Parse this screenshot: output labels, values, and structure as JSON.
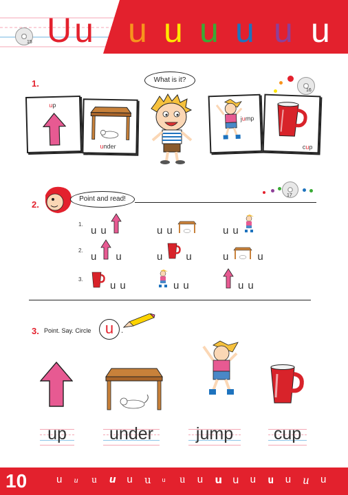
{
  "header": {
    "big_letters": "Uu",
    "cd_track": "15",
    "small_letters": [
      {
        "char": "u",
        "color": "#f7941d"
      },
      {
        "char": "u",
        "color": "#ffe600"
      },
      {
        "char": "u",
        "color": "#3aaa35"
      },
      {
        "char": "u",
        "color": "#1e73be"
      },
      {
        "char": "u",
        "color": "#8e3f98"
      },
      {
        "char": "u",
        "color": "#ffffff"
      }
    ]
  },
  "section1": {
    "number": "1.",
    "bubble": "What is it?",
    "cd_track": "16",
    "cards": [
      {
        "hl": "u",
        "rest": "p",
        "name": "up"
      },
      {
        "hl": "u",
        "rest": "nder",
        "name": "under"
      },
      {
        "pre": "j",
        "hl": "u",
        "rest": "mp",
        "name": "jump"
      },
      {
        "pre": "c",
        "hl": "u",
        "rest": "p",
        "name": "cup"
      }
    ]
  },
  "section2": {
    "number": "2.",
    "bubble": "Point and read!",
    "cd_track": "17",
    "rows": [
      {
        "n": "1.",
        "groups": [
          [
            "u",
            "u",
            "arrow"
          ],
          [
            "u",
            "u",
            "table"
          ],
          [
            "u",
            "u",
            "girl"
          ]
        ]
      },
      {
        "n": "2.",
        "groups": [
          [
            "u",
            "arrow",
            "u"
          ],
          [
            "u",
            "cup",
            "u"
          ],
          [
            "u",
            "table",
            "u"
          ]
        ]
      },
      {
        "n": "3.",
        "groups": [
          [
            "cup",
            "u",
            "u"
          ],
          [
            "girl",
            "u",
            "u"
          ],
          [
            "arrow",
            "u",
            "u"
          ]
        ]
      }
    ]
  },
  "section3": {
    "number": "3.",
    "instruction": "Point. Say. Circle",
    "circle_letter": "u",
    "trail": ".",
    "words": [
      "up",
      "under",
      "jump",
      "cup"
    ]
  },
  "footer": {
    "page_number": "10",
    "letters": [
      "u",
      "u",
      "u",
      "u",
      "u",
      "u",
      "u",
      "u",
      "u",
      "u",
      "u",
      "u",
      "u",
      "u",
      "u",
      "u"
    ]
  },
  "colors": {
    "red": "#e3212d",
    "pink": "#e75a92",
    "table": "#c8813a"
  }
}
